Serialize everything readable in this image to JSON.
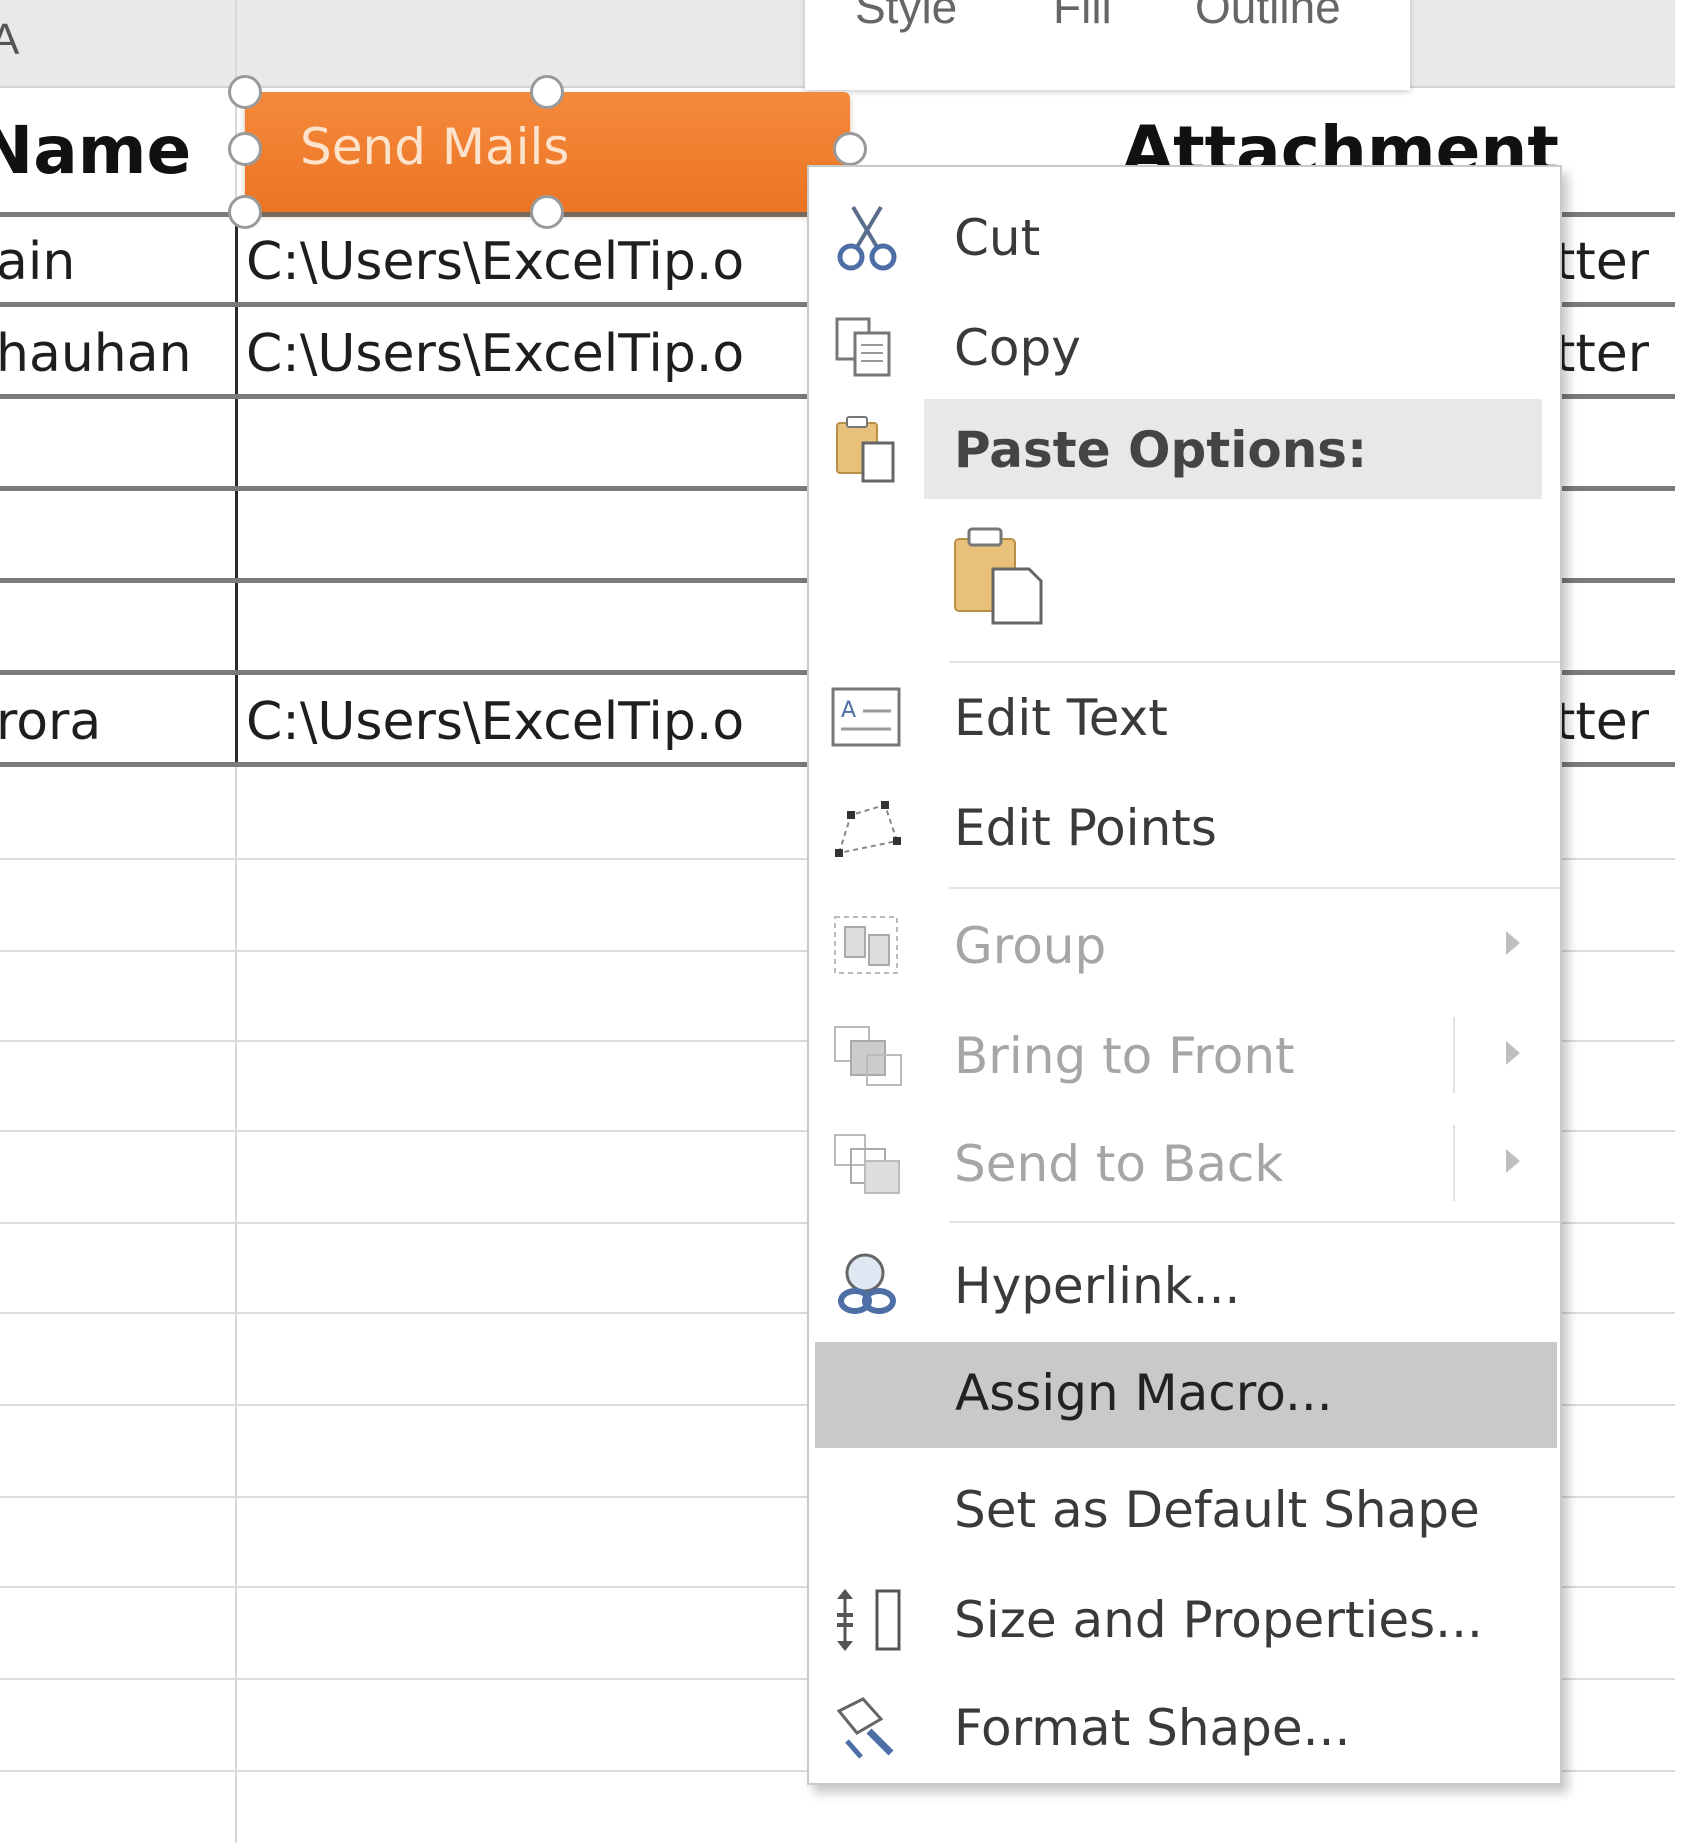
{
  "sheet": {
    "column_a_header": "A",
    "headers": {
      "name": "Name",
      "attachment": "Attachment"
    },
    "rows": [
      {
        "name": "ain",
        "path": "C:\\Users\\ExcelTip.o",
        "suffix": "tter"
      },
      {
        "name": "hauhan",
        "path": "C:\\Users\\ExcelTip.o",
        "suffix": "tter"
      },
      {
        "name": "",
        "path": "",
        "suffix": ""
      },
      {
        "name": "",
        "path": "",
        "suffix": ""
      },
      {
        "name": "rora",
        "path": "C:\\Users\\ExcelTip.o",
        "suffix": "tter"
      }
    ]
  },
  "shape": {
    "label": "Send Mails",
    "color": "#f07e2e"
  },
  "mini_toolbar": {
    "items": [
      "Style",
      "Fill",
      "Outline"
    ]
  },
  "context_menu": {
    "items": {
      "cut": "Cut",
      "copy": "Copy",
      "paste_options": "Paste Options:",
      "edit_text": "Edit Text",
      "edit_points": "Edit Points",
      "group": "Group",
      "bring_to_front": "Bring to Front",
      "send_to_back": "Send to Back",
      "hyperlink": "Hyperlink...",
      "assign_macro": "Assign Macro...",
      "set_default_shape": "Set as Default Shape",
      "size_properties": "Size and Properties...",
      "format_shape": "Format Shape..."
    },
    "icons": {
      "cut": "scissors-icon",
      "copy": "copy-icon",
      "paste": "clipboard-icon",
      "edit_text": "edit-text-icon",
      "edit_points": "edit-points-icon",
      "group": "group-icon",
      "bring_to_front": "bring-to-front-icon",
      "send_to_back": "send-to-back-icon",
      "hyperlink": "hyperlink-icon",
      "size_properties": "size-properties-icon",
      "format_shape": "format-shape-icon"
    },
    "highlight_color": "#c9c9c9"
  }
}
